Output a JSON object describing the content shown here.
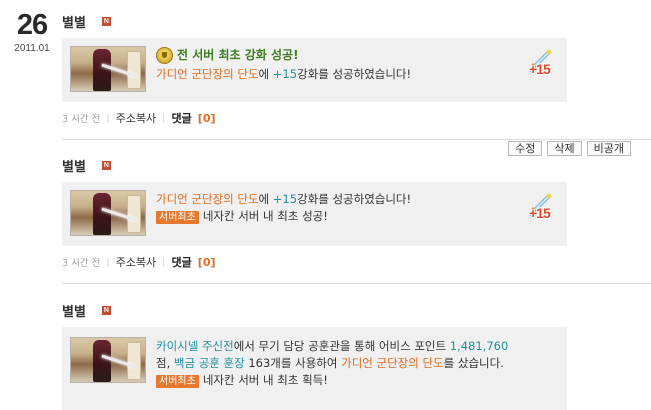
{
  "date": {
    "day": "26",
    "year_month": "2011.01"
  },
  "posts": [
    {
      "author": "별별",
      "new_badge": "N",
      "headline": "전 서버 최초 강화 성공!",
      "line1_item": "가디언 군단장의 단도",
      "line1_mid": "에 ",
      "line1_plus": "+15",
      "line1_end": "강화를 성공하였습니다!",
      "enhance_badge": "+15",
      "time": "3 시간 전",
      "copy_address": "주소복사",
      "comment_label": "댓글",
      "comment_count": "[0]"
    },
    {
      "author": "별별",
      "new_badge": "N",
      "line1_item": "가디언 군단장의 단도",
      "line1_mid": "에 ",
      "line1_plus": "+15",
      "line1_end": "강화를 성공하였습니다!",
      "tag": "서버최초",
      "tag_text": "네자칸 서버 내 최초 성공!",
      "enhance_badge": "+15",
      "time": "3 시간 전",
      "copy_address": "주소복사",
      "comment_label": "댓글",
      "comment_count": "[0]"
    },
    {
      "author": "별별",
      "new_badge": "N",
      "seg_a": "카이시넬 주신전",
      "seg_b": "에서 무기 담당 공훈관을 통해 어비스 포인트 ",
      "seg_c": "1,481,760",
      "seg_d": " 점, ",
      "seg_e": "백금 공훈 훈장",
      "seg_f": " 163개를 사용하여 ",
      "seg_g": "가디언 군단장의 단도",
      "seg_h": "를 샀습니다.",
      "tag": "서버최초",
      "tag_text": "네자칸 서버 내 최초 획득!"
    }
  ],
  "actions": {
    "edit": "수정",
    "delete": "삭제",
    "private": "비공개"
  },
  "colors": {
    "accent_orange": "#e26a1c",
    "teal": "#1f8ea1",
    "headline_green": "#3e7d1e",
    "card_bg": "#f0f0f0"
  }
}
